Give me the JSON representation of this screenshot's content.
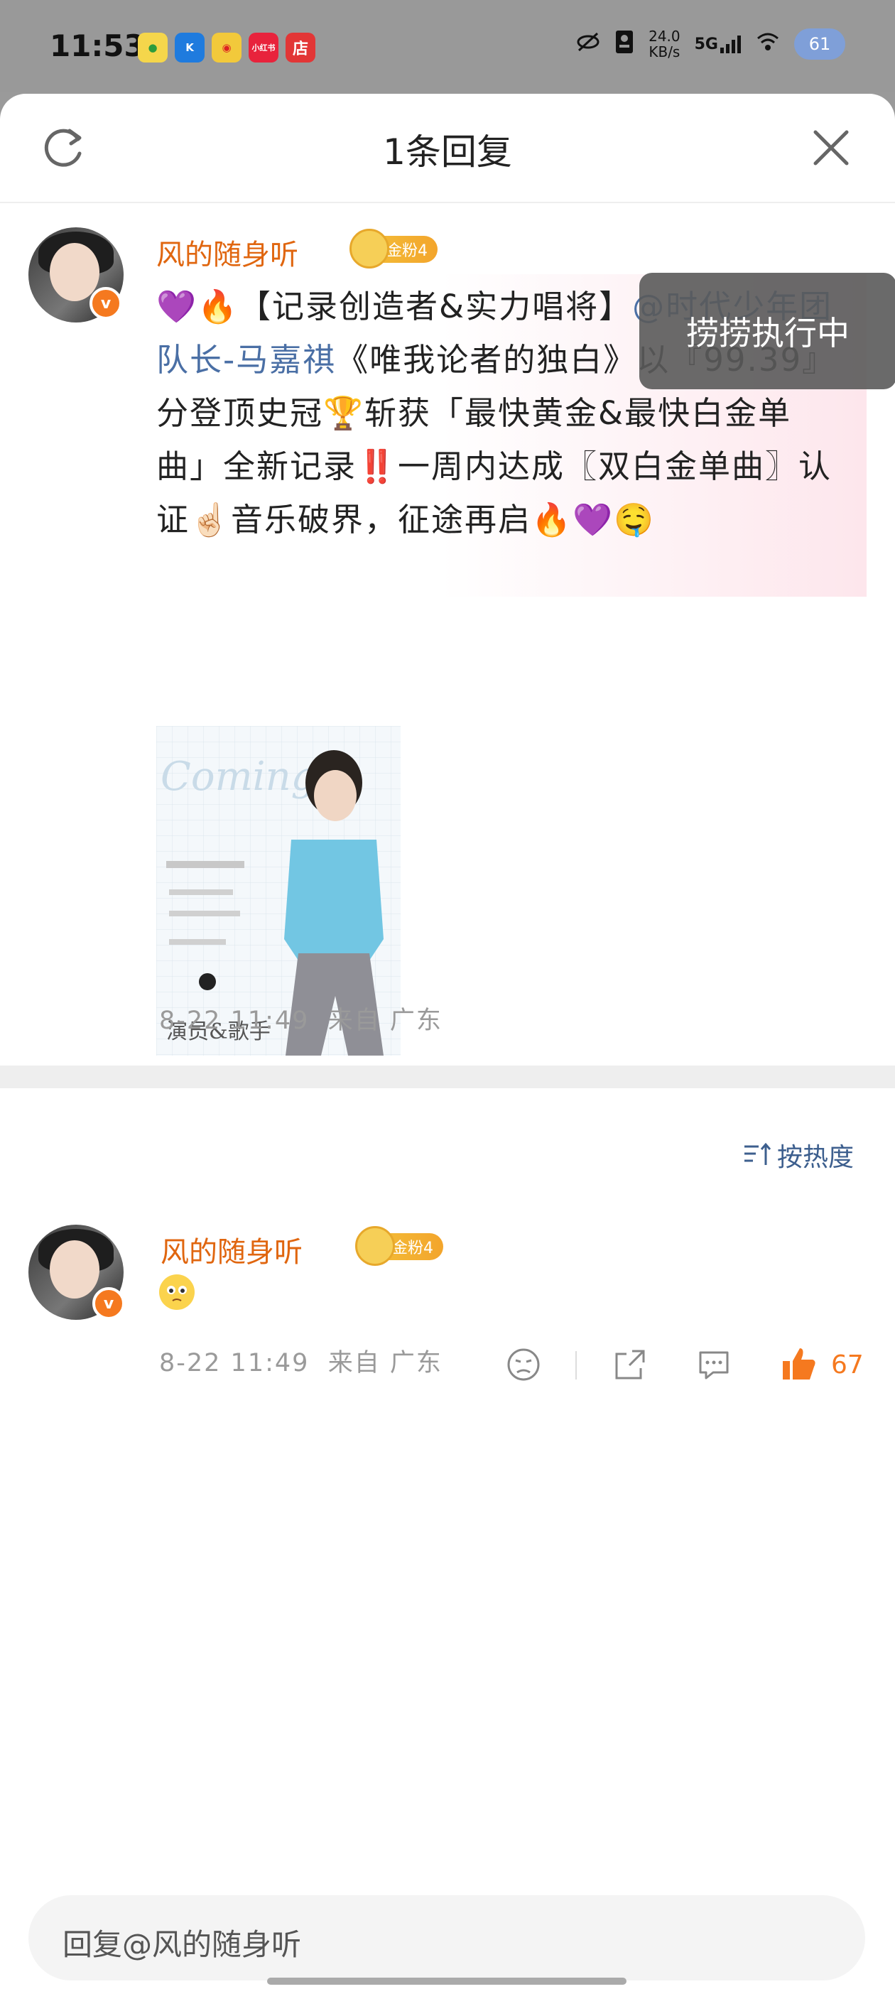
{
  "status_bar": {
    "time": "11:53",
    "app_icons": [
      {
        "name": "music-app-icon",
        "label": "",
        "color": "#f5d64b"
      },
      {
        "name": "kugou-app-icon",
        "label": "K",
        "color": "#1f7bde"
      },
      {
        "name": "weibo-app-icon",
        "label": "",
        "color": "#f2c93b"
      },
      {
        "name": "xiaohongshu-app-icon",
        "label": "小红书",
        "color": "#e8233c"
      },
      {
        "name": "shop-app-icon",
        "label": "店",
        "color": "#e23636"
      }
    ],
    "net_speed_value": "24.0",
    "net_speed_unit": "KB/s",
    "network": "5G",
    "battery": "61"
  },
  "header": {
    "title": "1条回复"
  },
  "original_post": {
    "username": "风的随身听",
    "fan_badge": "金粉4",
    "text_part1": "💜🔥【记录创造者&实力唱将】",
    "mention": "@时代少年团队长-马嘉祺",
    "text_part2": "《唯我论者的独白》以『99.39』分登顶史冠🏆斩获「最快黄金&最快白金单曲」全新记录‼️一周内达成〖双白金单曲〗认证☝🏻音乐破界，征途再启🔥💜🤤",
    "overlay_tag": "捞捞执行中",
    "image_text": "演员&歌手",
    "image_secondary_text": "Coming",
    "date": "8-22 11:49",
    "location": "来自 广东"
  },
  "sort": {
    "label": "按热度"
  },
  "reply": {
    "username": "风的随身听",
    "fan_badge": "金粉4",
    "date": "8-22 11:49",
    "location": "来自 广东",
    "like_count": "67"
  },
  "reply_input": {
    "placeholder": "回复@风的随身听"
  },
  "colors": {
    "username": "#e0660f",
    "mention": "#4a6fa5",
    "like": "#f5791f"
  }
}
